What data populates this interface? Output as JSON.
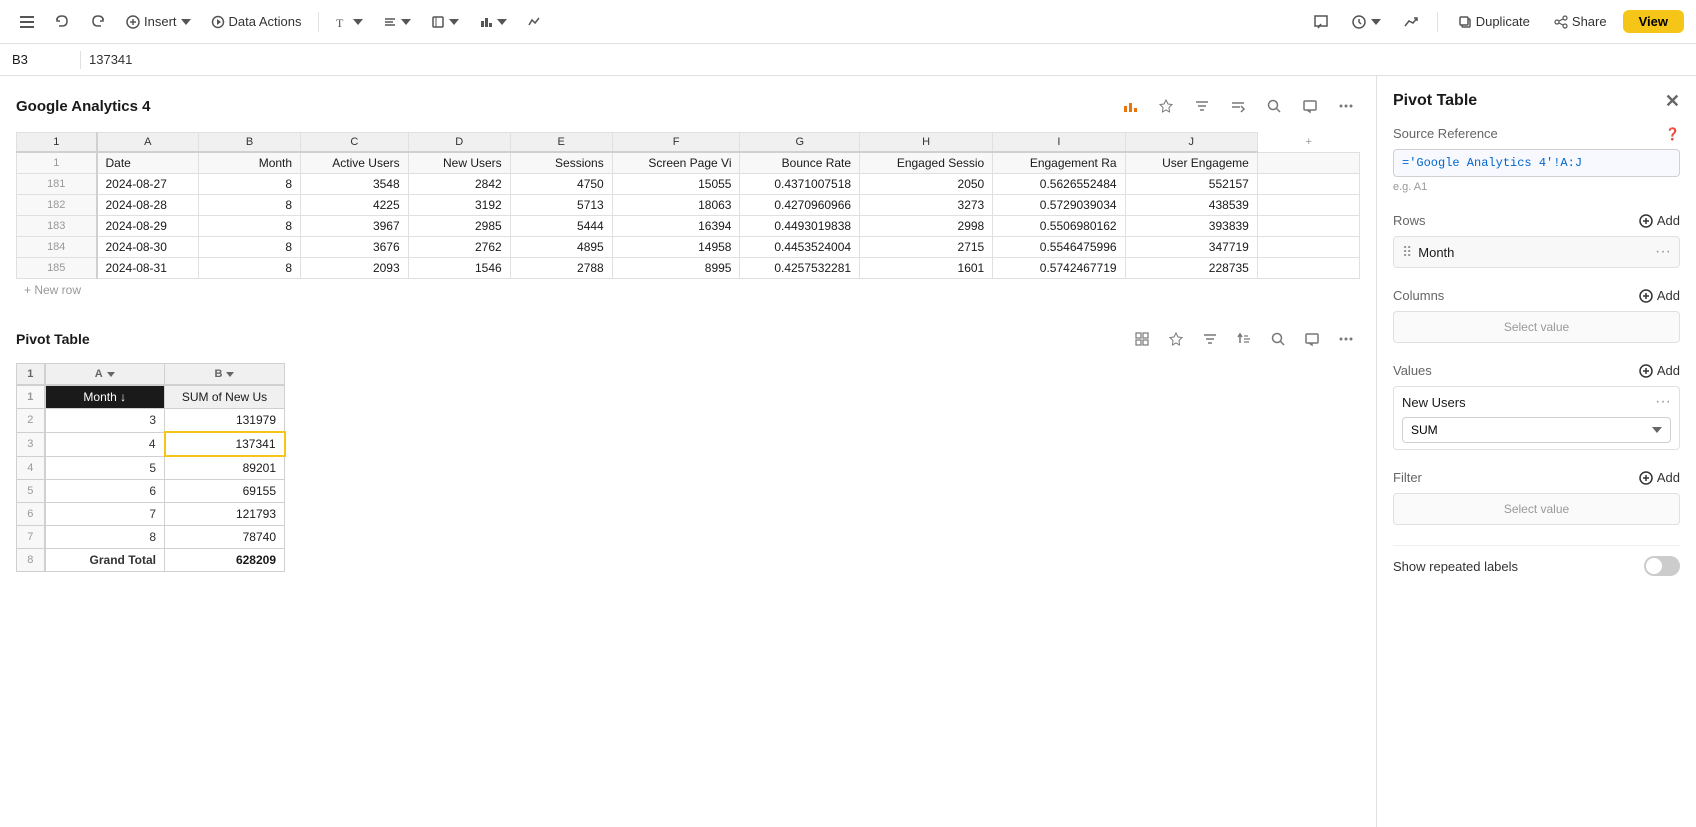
{
  "toolbar": {
    "insert_label": "Insert",
    "data_actions_label": "Data Actions",
    "duplicate_label": "Duplicate",
    "share_label": "Share",
    "view_label": "View"
  },
  "cell_ref": {
    "cell": "B3",
    "value": "137341"
  },
  "google_analytics": {
    "title": "Google Analytics 4",
    "columns": [
      "Date",
      "Month",
      "Active Users",
      "New Users",
      "Sessions",
      "Screen Page Vi",
      "Bounce Rate",
      "Engaged Sessio",
      "Engagement Ra",
      "User Engageme"
    ],
    "col_letters": [
      "A",
      "B",
      "C",
      "D",
      "E",
      "F",
      "G",
      "H",
      "I",
      "J"
    ],
    "rows": [
      {
        "num": "181",
        "date": "2024-08-27",
        "month": "8",
        "active_users": "3548",
        "new_users": "2842",
        "sessions": "4750",
        "screen_page": "15055",
        "bounce_rate": "0.4371007518",
        "engaged_s": "2050",
        "engagement_r": "0.5626552484",
        "user_e": "552157"
      },
      {
        "num": "182",
        "date": "2024-08-28",
        "month": "8",
        "active_users": "4225",
        "new_users": "3192",
        "sessions": "5713",
        "screen_page": "18063",
        "bounce_rate": "0.4270960966",
        "engaged_s": "3273",
        "engagement_r": "0.5729039034",
        "user_e": "438539"
      },
      {
        "num": "183",
        "date": "2024-08-29",
        "month": "8",
        "active_users": "3967",
        "new_users": "2985",
        "sessions": "5444",
        "screen_page": "16394",
        "bounce_rate": "0.4493019838",
        "engaged_s": "2998",
        "engagement_r": "0.5506980162",
        "user_e": "393839"
      },
      {
        "num": "184",
        "date": "2024-08-30",
        "month": "8",
        "active_users": "3676",
        "new_users": "2762",
        "sessions": "4895",
        "screen_page": "14958",
        "bounce_rate": "0.4453524004",
        "engaged_s": "2715",
        "engagement_r": "0.5546475996",
        "user_e": "347719"
      },
      {
        "num": "185",
        "date": "2024-08-31",
        "month": "8",
        "active_users": "2093",
        "new_users": "1546",
        "sessions": "2788",
        "screen_page": "8995",
        "bounce_rate": "0.4257532281",
        "engaged_s": "1601",
        "engagement_r": "0.5742467719",
        "user_e": "228735"
      }
    ],
    "new_row_label": "+ New row"
  },
  "pivot_table": {
    "title": "Pivot Table",
    "col_a_label": "A",
    "col_b_label": "B",
    "header_a": "Month ↓",
    "header_b": "SUM of New Us",
    "rows": [
      {
        "num": "2",
        "label": "3",
        "value": "131979"
      },
      {
        "num": "3",
        "label": "4",
        "value": "137341",
        "selected": true
      },
      {
        "num": "4",
        "label": "5",
        "value": "89201"
      },
      {
        "num": "5",
        "label": "6",
        "value": "69155"
      },
      {
        "num": "6",
        "label": "7",
        "value": "121793"
      },
      {
        "num": "7",
        "label": "8",
        "value": "78740"
      }
    ],
    "grand_total_label": "Grand Total",
    "grand_total_value": "628209",
    "grand_total_num": "8"
  },
  "right_panel": {
    "title": "Pivot Table",
    "source_reference_label": "Source Reference",
    "source_reference_value": "='Google Analytics 4'!A:J",
    "source_ref_placeholder": "e.g. A1",
    "rows_label": "Rows",
    "add_label": "Add",
    "row_item": "Month",
    "columns_label": "Columns",
    "columns_select_value": "Select value",
    "values_label": "Values",
    "new_users_label": "New Users",
    "sum_label": "SUM",
    "filter_label": "Filter",
    "filter_select_value": "Select value",
    "show_repeated_labels": "Show repeated labels",
    "toggle_state": "off"
  }
}
